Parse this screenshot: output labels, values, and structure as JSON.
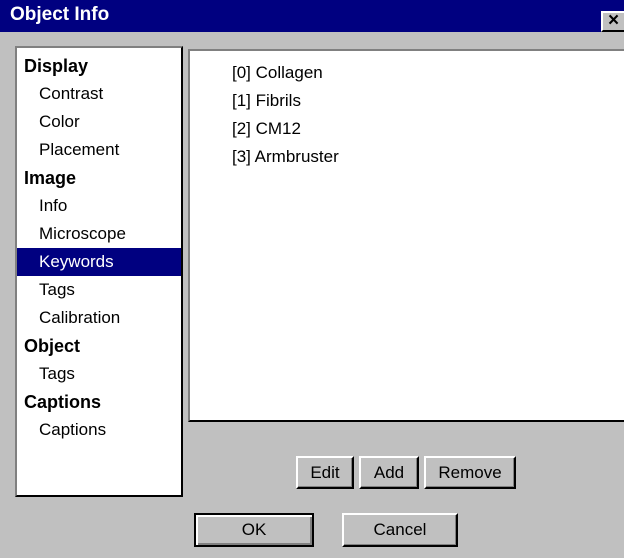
{
  "window": {
    "title": "Object Info",
    "close_label": "×"
  },
  "sidebar": {
    "items": [
      {
        "label": "Display",
        "type": "header"
      },
      {
        "label": "Contrast",
        "type": "item"
      },
      {
        "label": "Color",
        "type": "item"
      },
      {
        "label": "Placement",
        "type": "item"
      },
      {
        "label": "Image",
        "type": "header"
      },
      {
        "label": "Info",
        "type": "item"
      },
      {
        "label": "Microscope",
        "type": "item"
      },
      {
        "label": "Keywords",
        "type": "item",
        "selected": true
      },
      {
        "label": "Tags",
        "type": "item"
      },
      {
        "label": "Calibration",
        "type": "item"
      },
      {
        "label": "Object",
        "type": "header"
      },
      {
        "label": "Tags",
        "type": "item"
      },
      {
        "label": "Captions",
        "type": "header"
      },
      {
        "label": "Captions",
        "type": "item"
      }
    ]
  },
  "keywords": {
    "items": [
      "[0] Collagen",
      "[1] Fibrils",
      "[2] CM12",
      "[3] Armbruster"
    ]
  },
  "buttons": {
    "edit": "Edit",
    "add": "Add",
    "remove": "Remove",
    "ok": "OK",
    "cancel": "Cancel"
  },
  "colors": {
    "titlebar": "#000080",
    "selection": "#000080",
    "face": "#c0c0c0"
  }
}
